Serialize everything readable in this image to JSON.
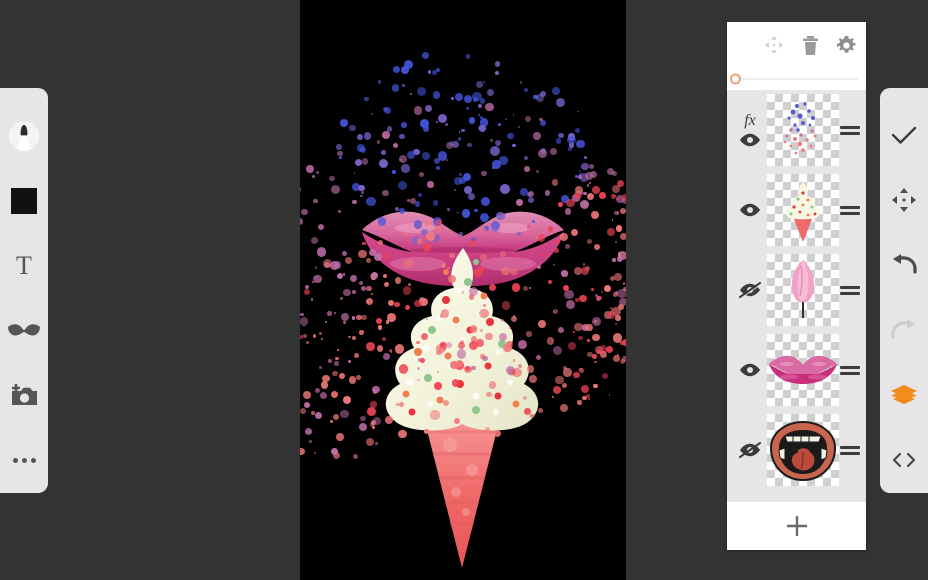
{
  "app": {
    "background_color": "#333333",
    "canvas_background": "#000000",
    "accent_color": "#F28C18",
    "panel_bg": "#E6E6E6"
  },
  "left_toolbar": {
    "items": [
      {
        "name": "brush-tool",
        "icon": "brush-icon",
        "label": "Brush",
        "active": true
      },
      {
        "name": "color-swatch",
        "icon": "color-square-icon",
        "label": "Color",
        "value": "#111111"
      },
      {
        "name": "text-tool",
        "icon": "text-icon",
        "label": "T"
      },
      {
        "name": "sticker-tool",
        "icon": "moustache-icon",
        "label": "Sticker"
      },
      {
        "name": "add-photo-tool",
        "icon": "camera-plus-icon",
        "label": "Add Photo"
      },
      {
        "name": "more-tools",
        "icon": "ellipsis-icon",
        "label": "More"
      }
    ]
  },
  "right_toolbar": {
    "items": [
      {
        "name": "confirm-button",
        "icon": "check-icon",
        "label": "Done",
        "enabled": true
      },
      {
        "name": "transform-button",
        "icon": "move-icon",
        "label": "Transform",
        "enabled": true
      },
      {
        "name": "undo-button",
        "icon": "undo-icon",
        "label": "Undo",
        "enabled": true
      },
      {
        "name": "redo-button",
        "icon": "redo-icon",
        "label": "Redo",
        "enabled": false
      },
      {
        "name": "layers-button",
        "icon": "layers-icon",
        "label": "Layers",
        "enabled": true,
        "active": true
      },
      {
        "name": "code-button",
        "icon": "code-brackets-icon",
        "label": "Code",
        "enabled": true
      }
    ]
  },
  "layers_panel": {
    "header_buttons": [
      {
        "name": "move-layer-button",
        "icon": "move-icon",
        "label": "Move",
        "enabled": false
      },
      {
        "name": "delete-layer-button",
        "icon": "trash-icon",
        "label": "Delete",
        "enabled": true
      },
      {
        "name": "layer-settings-button",
        "icon": "gear-icon",
        "label": "Settings",
        "enabled": true
      }
    ],
    "opacity_slider": {
      "name": "opacity-slider",
      "value": 0,
      "min": 0,
      "max": 100,
      "handle_color": "#F2A27C"
    },
    "layers": [
      {
        "name": "layer-confetti",
        "thumbnail": "confetti-thumb",
        "visible": true,
        "has_fx": true,
        "handle": "drag-handle"
      },
      {
        "name": "layer-ice-cream",
        "thumbnail": "ice-cream-thumb",
        "visible": true,
        "has_fx": false,
        "handle": "drag-handle"
      },
      {
        "name": "layer-cotton-candy",
        "thumbnail": "cotton-candy-thumb",
        "visible": false,
        "has_fx": false,
        "handle": "drag-handle"
      },
      {
        "name": "layer-lips",
        "thumbnail": "lips-thumb",
        "visible": true,
        "has_fx": false,
        "handle": "drag-handle"
      },
      {
        "name": "layer-open-mouth",
        "thumbnail": "open-mouth-thumb",
        "visible": false,
        "has_fx": false,
        "handle": "drag-handle"
      }
    ],
    "add_layer": {
      "name": "add-layer-button",
      "icon": "plus-icon",
      "label": "+"
    }
  },
  "canvas": {
    "name": "artwork-canvas",
    "artwork_elements": [
      {
        "name": "lips-artwork",
        "color": "#D4418E"
      },
      {
        "name": "ice-cream-artwork",
        "cream_color": "#F5F5E0",
        "cone_color": "#F07878"
      },
      {
        "name": "confetti-artwork",
        "colors": [
          "#4455DD",
          "#7B62C9",
          "#C06FA8",
          "#F07878",
          "#EE4455"
        ]
      }
    ]
  }
}
